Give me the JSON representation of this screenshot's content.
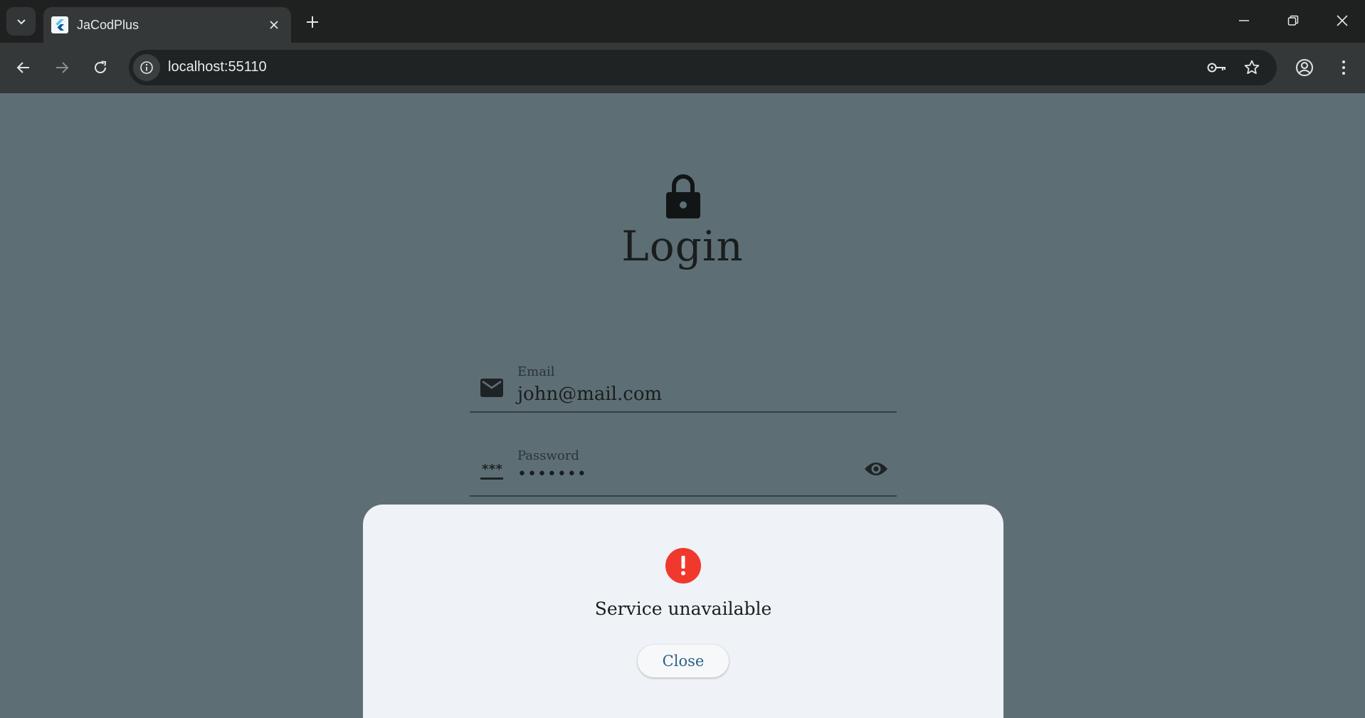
{
  "browser": {
    "tab_title": "JaCodPlus",
    "url": "localhost:55110"
  },
  "login": {
    "title": "Login",
    "email": {
      "label": "Email",
      "value": "john@mail.com"
    },
    "password": {
      "label": "Password",
      "value": "•••••••",
      "prefix_glyph": "***"
    }
  },
  "dialog": {
    "message": "Service unavailable",
    "close_label": "Close"
  },
  "colors": {
    "page_background": "#5d6f75",
    "sheet_background": "#eff2f6",
    "error_red": "#f0392c",
    "button_text": "#2d6184"
  }
}
